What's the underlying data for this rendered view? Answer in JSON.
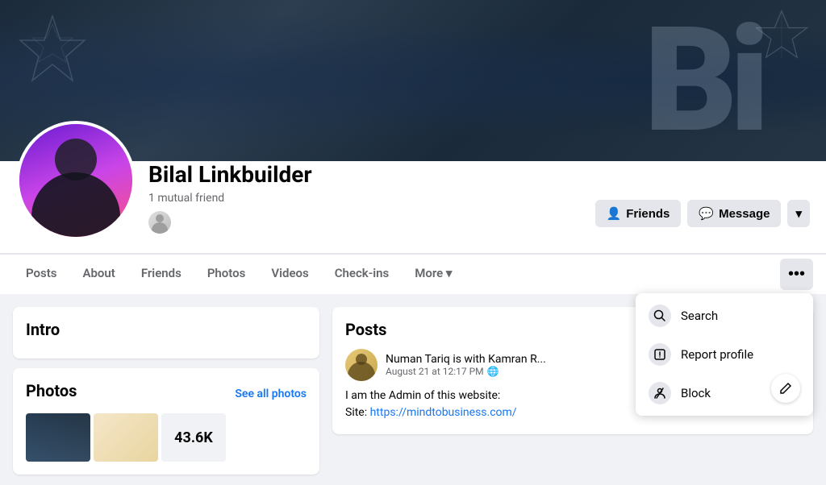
{
  "profile": {
    "name": "Bilal Linkbuilder",
    "mutual_friends": "1 mutual friend",
    "cover_letters": "Bi"
  },
  "actions": {
    "friends_label": "Friends",
    "message_label": "Message",
    "more_chevron": "▾"
  },
  "nav": {
    "tabs": [
      {
        "label": "Posts",
        "active": false
      },
      {
        "label": "About",
        "active": false
      },
      {
        "label": "Friends",
        "active": false
      },
      {
        "label": "Photos",
        "active": false
      },
      {
        "label": "Videos",
        "active": false
      },
      {
        "label": "Check-ins",
        "active": false
      },
      {
        "label": "More ▾",
        "active": false
      }
    ],
    "more_dots": "•••"
  },
  "left_column": {
    "intro_title": "Intro",
    "photos_title": "Photos",
    "see_all_photos": "See all photos",
    "photo_count": "43.6K"
  },
  "right_column": {
    "posts_title": "Posts",
    "post": {
      "author": "Numan Tariq",
      "with_text": "is with",
      "tagged": "Kamran R...",
      "time": "August 21 at 12:17 PM",
      "privacy": "🌐",
      "body_line1": "I am the Admin of this website:",
      "body_line2": "Site: ",
      "link": "https://mindtobusiness.com/"
    }
  },
  "dropdown": {
    "items": [
      {
        "icon": "🔍",
        "label": "Search"
      },
      {
        "icon": "⚠",
        "label": "Report profile"
      },
      {
        "icon": "🚫",
        "label": "Block"
      }
    ]
  },
  "colors": {
    "accent": "#1877f2",
    "bg": "#f0f2f5",
    "card_bg": "#ffffff"
  }
}
